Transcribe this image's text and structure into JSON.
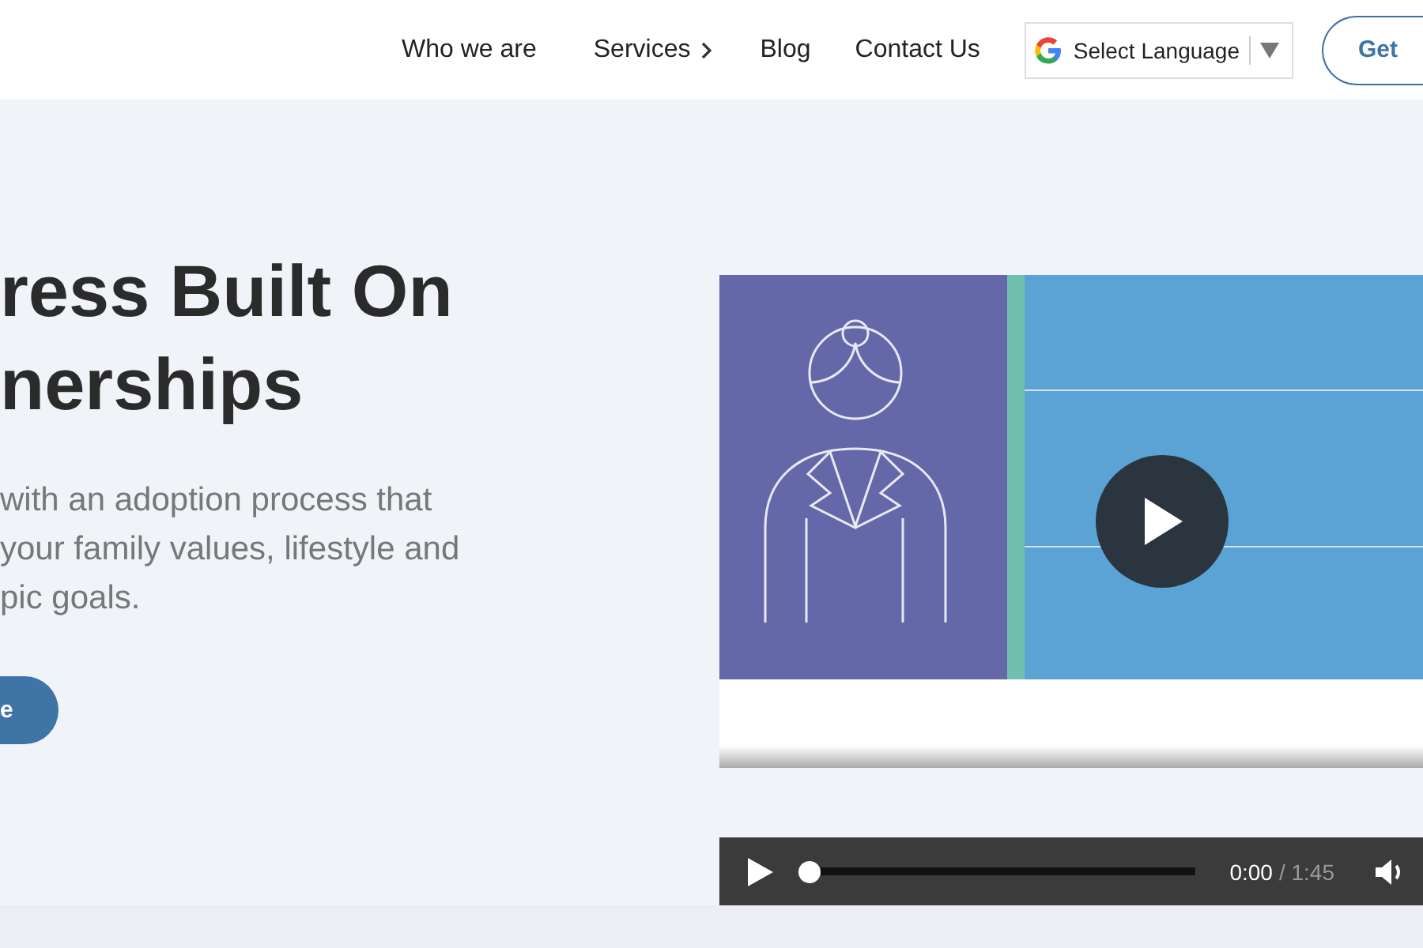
{
  "nav": {
    "items": [
      {
        "label": "Who we are",
        "kind": "link"
      },
      {
        "label": "Services",
        "kind": "dropdown"
      },
      {
        "label": "Blog",
        "kind": "link"
      },
      {
        "label": "Contact Us",
        "kind": "link"
      }
    ],
    "language_select": {
      "label": "Select Language"
    },
    "cta_button": {
      "label": "Get"
    }
  },
  "hero": {
    "heading_lines": [
      "ress Built On",
      "nerships"
    ],
    "paragraph_lines": [
      "with an adoption process that",
      "your family values, lifestyle and",
      "pic goals."
    ],
    "button": {
      "label": "e"
    }
  },
  "video_player": {
    "current_time": "0:00",
    "duration": "/ 1:45",
    "level": 0
  }
}
